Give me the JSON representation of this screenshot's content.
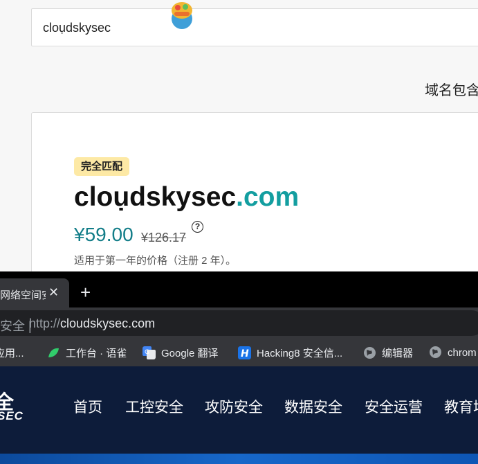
{
  "search": {
    "value": "cloụdskysec"
  },
  "filter": {
    "contains_label": "域名包含"
  },
  "result": {
    "badge": "完全匹配",
    "domain_name": "cloụdskysec",
    "domain_tld": ".com",
    "price": "¥59.00",
    "original_price": "¥126.17",
    "help_glyph": "?",
    "price_note": "适用于第一年的价格（注册 2 年）。"
  },
  "browser": {
    "tab": {
      "title": "网络空间安",
      "close": "✕"
    },
    "new_tab": "+",
    "omnibox": {
      "security": "安全",
      "separator": "|",
      "scheme": "http://",
      "host": "cloudskysec.com"
    },
    "bookmarks": [
      {
        "label": "应用...",
        "icon": "apps-icon",
        "color": "#8ab4f8"
      },
      {
        "label": "工作台 · 语雀",
        "icon": "yuque-icon",
        "color": "#31cc6b"
      },
      {
        "label": "Google 翻译",
        "icon": "google-translate-icon",
        "color": "#4285f4"
      },
      {
        "label": "Hacking8 安全信...",
        "icon": "hacking8-icon",
        "color": "#1a73e8"
      },
      {
        "label": "编辑器",
        "icon": "globe-icon",
        "color": "#9aa0a6"
      },
      {
        "label": "chrom",
        "icon": "globe-icon",
        "color": "#9aa0a6"
      }
    ]
  },
  "site": {
    "logo_text": "全",
    "logo_sub": "SEC",
    "nav": [
      "首页",
      "工控安全",
      "攻防安全",
      "数据安全",
      "安全运营",
      "教育培"
    ]
  },
  "colors": {
    "tld": "#139ea0",
    "price": "#127d88",
    "badge_bg": "#fde9a5",
    "site_header": "#0d1c3a"
  }
}
